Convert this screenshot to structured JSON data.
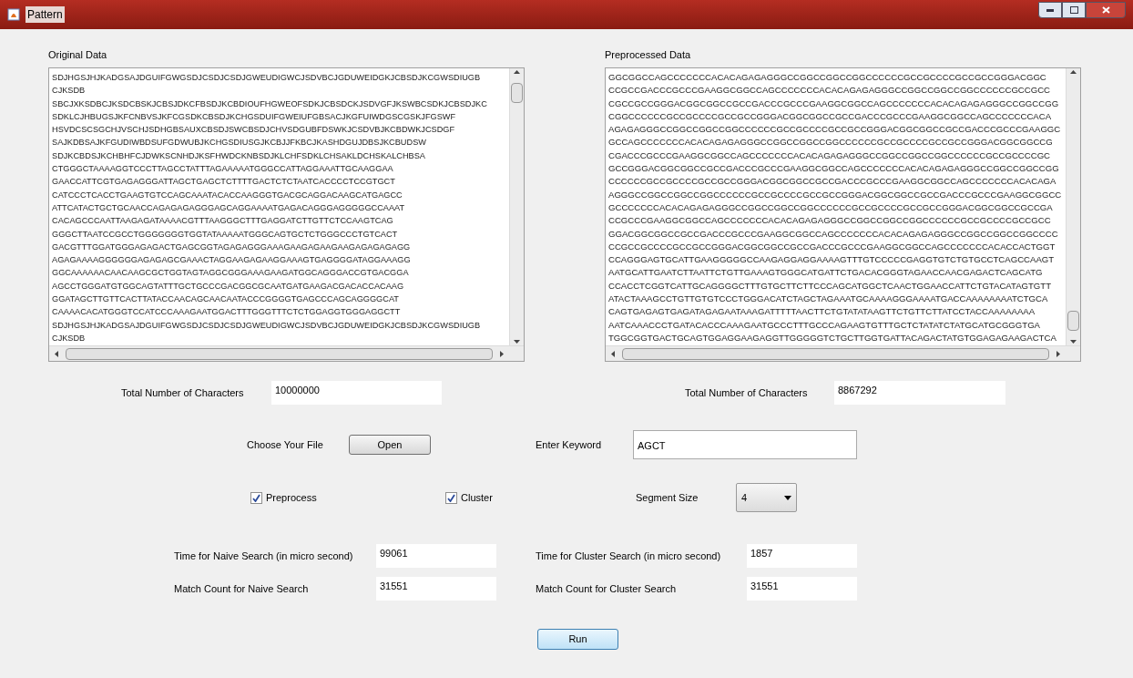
{
  "window": {
    "title": "Pattern"
  },
  "original": {
    "label": "Original Data",
    "lines": [
      "SDJHGSJHJKADGSAJDGUIFGWGSDJCSDJCSDJGWEUDIGWCJSDVBCJGDUWEIDGKJCBSDJKCGWSDIUGB",
      "CJKSDB",
      "SBCJXKSDBCJKSDCBSKJCBSJDKCFBSDJKCBDIOUFHGWEOFSDKJCBSDCKJSDVGFJKSWBCSDKJCBSDJKC",
      "SDKLCJHBUGSJKFCNBVSJKFCGSDKCBSDJKCHGSDUIFGWEIUFGBSACJKGFUIWDGSCGSKJFGSWF",
      "HSVDCSCSGCHJVSCHJSDHGBSAUXCBSDJSWCBSDJCHVSDGUBFDSWKJCSDVBJKCBDWKJCSDGF",
      "SAJKDBSAJKFGUDIWBDSUFGDWUBJKCHGSDIUSGJKCBJJFKBCJKASHDGUJDBSJKCBUDSW",
      "SDJKCBDSJKCHBHFCJDWKSCNHDJKSFHWDCKNBSDJKLCHFSDKLCHSAKLDCHSKALCHBSA",
      "CTGGGCTAAAAGGTCCCTTAGCCTATTTAGAAAAATGGGCCATTAGGAAATTGCAAGGAA",
      "GAACCATTCGTGAGAGGGATTAGCTGAGCTCTTTTGACTCTCTAATCACCCCTCCGTGCT",
      "CATCCCTCACCTGAAGTGTCCAGCAAATACACCAAGGGTGACGCAGGACAAGCATGAGCC",
      "ATTCATACTGCTGCAACCAGAGAGAGGGAGCAGGAAAATGAGACAGGGAGGGGGCCAAAT",
      "CACAGCCCAATTAAGAGATAAAACGTTTAAGGGCTTTGAGGATCTTGTTCTCCAAGTCAG",
      "GGGCTTAATCCGCCTGGGGGGGTGGTATAAAAATGGGCAGTGCTCTGGGCCCTGTCACT",
      "GACGTTTGGATGGGAGAGACTGAGCGGTAGAGAGGGAAAGAAGAGAAGAAGAGAGAGAGG",
      "AGAGAAAAGGGGGGAGAGAGCGAAACTAGGAAGAGAAGGAAAGTGAGGGGATAGGAAAGG",
      "GGCAAAAAACAACAAGCGCTGGTAGTAGGCGGGAAAGAAGATGGCAGGGACCGTGACGGA",
      "AGCCTGGGATGTGGCAGTATTTGCTGCCCGACGGCGCAATGATGAAGACGACACCACAAG",
      "GGATAGCTTGTTCACTTATACCAACAGCAACAATACCCGGGGTGAGCCCAGCAGGGGCAT",
      "CAAAACACATGGGTCCATCCCAAAGAATGGACTTTGGGTTTCTCTGGAGGTGGGAGGCTT",
      "SDJHGSJHJKADGSAJDGUIFGWGSDJCSDJCSDJGWEUDIGWCJSDVBCJGDUWEIDGKJCBSDJKCGWSDIUGB",
      "CJKSDB"
    ],
    "total_label": "Total Number of Characters",
    "total_value": "10000000"
  },
  "preprocessed": {
    "label": "Preprocessed Data",
    "lines": [
      "GGCGGCCAGCCCCCCCACACAGAGAGGGCCGGCCGGCCGGCCCCCCGCCGCCCCGCCGCCGGGACGGC",
      "CCGCCGACCCGCCCGAAGGCGGCCAGCCCCCCCACACAGAGAGGGCCGGCCGGCCGGCCCCCCGCCGCC",
      "CGCCGCCGGGACGGCGGCCGCCGACCCGCCCGAAGGCGGCCAGCCCCCCCACACAGAGAGGGCCGGCCGG",
      "CGGCCCCCCGCCGCCCCGCCGCCGGGACGGCGGCCGCCGACCCGCCCGAAGGCGGCCAGCCCCCCCACA",
      "AGAGAGGGCCGGCCGGCCGGCCCCCCGCCGCCCCGCCGCCGGGACGGCGGCCGCCGACCCGCCCGAAGGC",
      "GCCAGCCCCCCCACACAGAGAGGGCCGGCCGGCCGGCCCCCCGCCGCCCCGCCGCCGGGACGGCGGCCG",
      "CGACCCGCCCGAAGGCGGCCAGCCCCCCCACACAGAGAGGGCCGGCCGGCCGGCCCCCCGCCGCCCCGC",
      "GCCGGGACGGCGGCCGCCGACCCGCCCGAAGGCGGCCAGCCCCCCCACACAGAGAGGGCCGGCCGGCCGG",
      "CCCCCCGCCGCCCCGCCGCCGGGACGGCGGCCGCCGACCCGCCCGAAGGCGGCCAGCCCCCCCACACAGA",
      "AGGGCCGGCCGGCCGGCCCCCCGCCGCCCCGCCGCCGGGACGGCGGCCGCCGACCCGCCCGAAGGCGGCC",
      "GCCCCCCCACACAGAGAGGGCCGGCCGGCCGGCCCCCCGCCGCCCCGCCGCCGGGACGGCGGCCGCCGA",
      "CCGCCCGAAGGCGGCCAGCCCCCCCACACAGAGAGGGCCGGCCGGCCGGCCCCCCGCCGCCCCGCCGCC",
      "GGACGGCGGCCGCCGACCCGCCCGAAGGCGGCCAGCCCCCCCACACAGAGAGGGCCGGCCGGCCGGCCCC",
      "CCGCCGCCCCGCCGCCGGGACGGCGGCCGCCGACCCGCCCGAAGGCGGCCAGCCCCCCCACACCACTGGT",
      "CCAGGGAGTGCATTGAAGGGGGCCAAGAGGAGGAAAAGTTTGTCCCCCGAGGTGTCTGTGCCTCAGCCAAGT",
      "AATGCATTGAATCTTAATTCTGTTGAAAGTGGGCATGATTCTGACACGGGTAGAACCAACGAGACTCAGCATG",
      "CCACCTCGGTCATTGCAGGGGCTTTGTGCTTCTTCCCAGCATGGCTCAACTGGAACCATTCTGTACATAGTGTT",
      "ATACTAAAGCCTGTTGTGTCCCTGGGACATCTAGCTAGAAATGCAAAAGGGAAAATGACCAAAAAAAATCTGCA",
      "CAGTGAGAGTGAGATAGAGAATAAAGATTTTTAACTTCTGTATATAAGTTCTGTTCTTATCCTACCAAAAAAAA",
      "AATCAAACCCTGATACACCCAAAGAATGCCCTTTGCCCAGAAGTGTTTGCTCTATATCTATGCATGCGGGTGA",
      "TGGCGGTGACTGCAGTGGAGGAAGAGGTTGGGGGTCTGCTTGGTGATTACAGACTATGTGGAGAGAAGACTCA"
    ],
    "total_label": "Total Number of Characters",
    "total_value": "8867292"
  },
  "file": {
    "label": "Choose Your File",
    "button": "Open"
  },
  "keyword": {
    "label": "Enter Keyword",
    "value": "AGCT"
  },
  "options": [
    {
      "label": "Preprocess",
      "checked": true
    },
    {
      "label": "Cluster",
      "checked": true
    }
  ],
  "segment": {
    "label": "Segment Size",
    "value": "4"
  },
  "results": [
    {
      "label": "Time for Naive Search (in micro second)",
      "value": "99061"
    },
    {
      "label": "Time for Cluster Search (in micro second)",
      "value": "1857"
    },
    {
      "label": "Match Count for Naive Search",
      "value": "31551"
    },
    {
      "label": "Match Count for Cluster Search",
      "value": "31551"
    }
  ],
  "run_button": "Run"
}
